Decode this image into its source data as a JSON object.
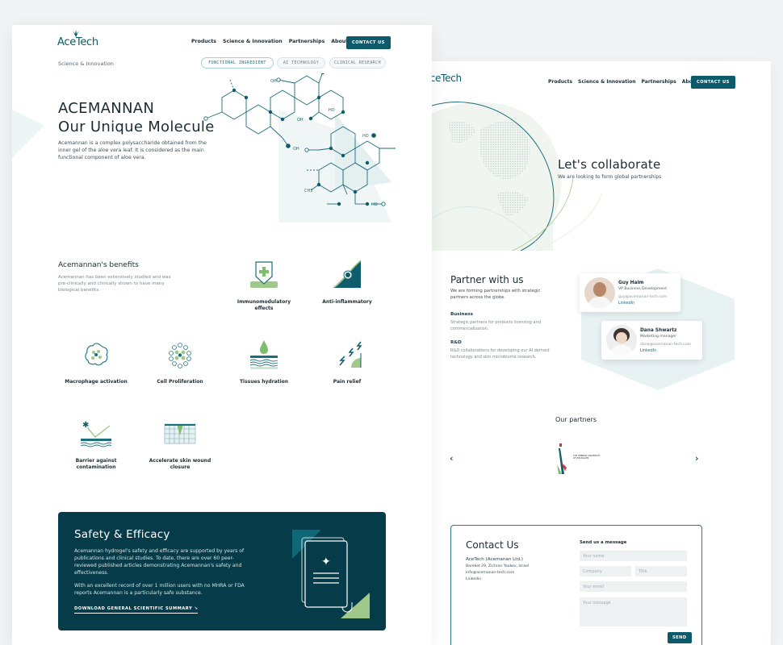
{
  "left_page": {
    "logo": "AceTech",
    "nav": [
      "Products",
      "Science & Innovation",
      "Partnerships",
      "About"
    ],
    "contact_button": "CONTACT US",
    "breadcrumb": "Science & Innovation",
    "tabs": [
      {
        "label": "FUNCTIONAL INGREDIENT",
        "active": true
      },
      {
        "label": "AI TECHNOLOGY",
        "active": false
      },
      {
        "label": "CLINICAL RESEARCH",
        "active": false
      }
    ],
    "hero": {
      "title_line1": "ACEMANNAN",
      "title_line2": "Our Unique Molecule",
      "description": "Acemannan is a complex polysaccharide obtained from the inner gel of the aloe vera leaf. It is considered as the main functional component of aloe vera.",
      "molecule_labels": [
        "OH",
        "OH",
        "HO",
        "OH",
        "HO",
        "HO",
        "CH3"
      ]
    },
    "benefits": {
      "title": "Acemannan's benefits",
      "description": "Acemannan has been extensively studied and was pre-clinically and clinically shown to have many biological benefits.",
      "items": [
        {
          "label": "Immunomodulatory effects",
          "icon": "shield-plus-icon"
        },
        {
          "label": "Anti-inflammatory",
          "icon": "triangle-wave-icon"
        },
        {
          "label": "Macrophage activation",
          "icon": "macrophage-icon"
        },
        {
          "label": "Cell Proliferation",
          "icon": "cell-cluster-icon"
        },
        {
          "label": "Tissues hydration",
          "icon": "droplet-layers-icon"
        },
        {
          "label": "Pain relief",
          "icon": "lightning-icon"
        },
        {
          "label": "Barrier against contamination",
          "icon": "barrier-icon"
        },
        {
          "label": "Accelerate skin wound closure",
          "icon": "skin-wound-icon"
        }
      ]
    },
    "safety": {
      "title": "Safety & Efficacy",
      "paragraph1": "Acemannan hydrogel's safety and efficacy are supported by years of publications and clinical studies. To date, there are over 60 peer-reviewed published articles demonstrating Acemannan's safety and effectiveness.",
      "paragraph2": "With an excellent record of over 1 million users with no MHRA or FDA reports Acemannan is a particularly safe substance.",
      "download_link": "DOWNLOAD GENERAL SCIENTIFIC SUMMARY ↘",
      "icon": "document-sparkle-icon"
    }
  },
  "right_page": {
    "logo": "AceTech",
    "nav": [
      "Products",
      "Science & Innovation",
      "Partnerships",
      "About"
    ],
    "contact_button": "CONTACT US",
    "hero": {
      "title": "Let's collaborate",
      "subtitle": "We are looking to form global partnerships"
    },
    "partner": {
      "title": "Partner with us",
      "intro": "We are forming partnerships with strategic partners across the globe.",
      "sections": [
        {
          "heading": "Business",
          "text": "Strategic partners for products licensing and commercialization."
        },
        {
          "heading": "R&D",
          "text": "R&D collaborations for developing our AI derived technology and skin microbiome research."
        }
      ],
      "contacts": [
        {
          "name": "Guy Haim",
          "role": "VP Business Development",
          "email": "guy@acemanan-tech.com",
          "link": "LinkedIn"
        },
        {
          "name": "Dana Shwartz",
          "role": "Marketing manager",
          "email": "dana@acemanan-tech.com",
          "link": "LinkedIn"
        }
      ]
    },
    "partners_section": {
      "title": "Our partners",
      "partner_logo_text": "THE HEBREW UNIVERSITY OF JERUSALEM"
    },
    "contact": {
      "title": "Contact Us",
      "company": "AceTech (Acemanan Ltd.)",
      "address": "Bareket 29, Zichron Yaakov, Israel",
      "email": "info@acemanan-tech.com",
      "linkedin": "Linkedin",
      "form_title": "Send us a message",
      "placeholders": {
        "name": "Your name",
        "company": "Company",
        "title": "Title",
        "email": "Your email",
        "message": "Your message"
      },
      "send_button": "SEND"
    }
  },
  "colors": {
    "brand_teal": "#0d5a6a",
    "dark_teal": "#063c49",
    "accent_green": "#9fc98a",
    "background": "#f1f3f4"
  }
}
